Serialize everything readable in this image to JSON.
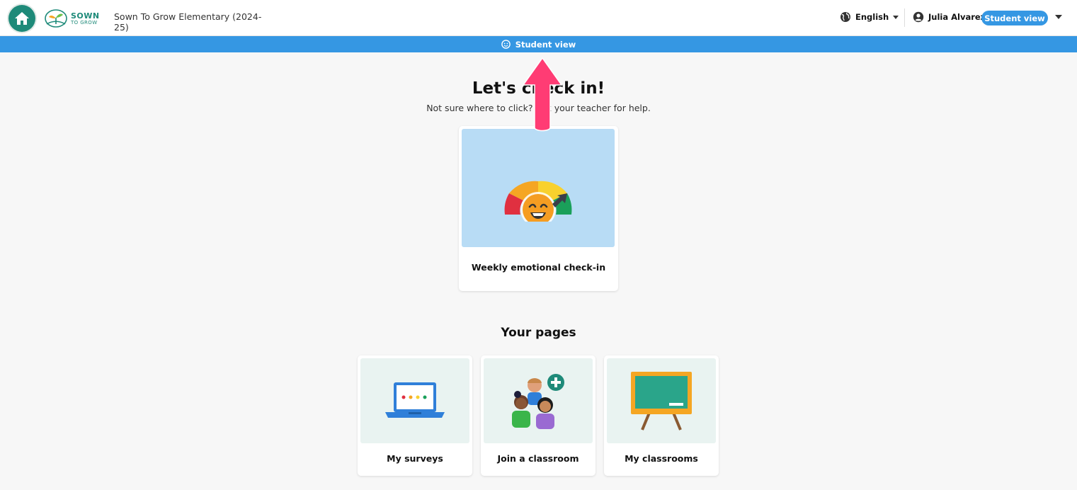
{
  "header": {
    "logo_line1": "SOWN",
    "logo_line2": "TO GROW",
    "school": "Sown To Grow Elementary (2024-25)",
    "language": "English",
    "user_name": "Julia Alvarez",
    "view_pill": "Student view"
  },
  "banner": {
    "label": "Student view"
  },
  "checkin": {
    "title": "Let's check in!",
    "subtitle": "Not sure where to click? Ask your teacher for help.",
    "card_label": "Weekly emotional check-in"
  },
  "pages": {
    "title": "Your pages",
    "items": [
      {
        "label": "My surveys",
        "icon": "laptop-icon"
      },
      {
        "label": "Join a classroom",
        "icon": "students-add-icon"
      },
      {
        "label": "My classrooms",
        "icon": "chalkboard-icon"
      }
    ]
  },
  "colors": {
    "brand_teal": "#1e8a79",
    "banner_blue": "#3597e3",
    "annotation_pink": "#ff3c74"
  }
}
